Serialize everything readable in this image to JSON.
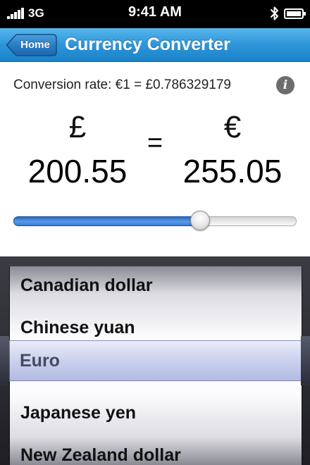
{
  "status_bar": {
    "carrier": "3G",
    "time": "9:41 AM",
    "icons": [
      "signal-strength-icon",
      "bluetooth-icon",
      "battery-icon"
    ]
  },
  "nav_bar": {
    "back_label": "Home",
    "title": "Currency Converter",
    "color": "#2d95d8"
  },
  "converter": {
    "rate_text": "Conversion rate: €1 = £0.786329179",
    "info_icon": "info-icon",
    "from_symbol": "£",
    "from_amount": "200.55",
    "equals": "=",
    "to_symbol": "€",
    "to_amount": "255.05",
    "slider_value": 0.66,
    "slider_color": "#3a7ad6"
  },
  "picker": {
    "items": [
      "Canadian dollar",
      "Chinese yuan",
      "Euro",
      "Japanese yen",
      "New Zealand dollar"
    ],
    "selected": "Euro",
    "selected_index": 2
  }
}
